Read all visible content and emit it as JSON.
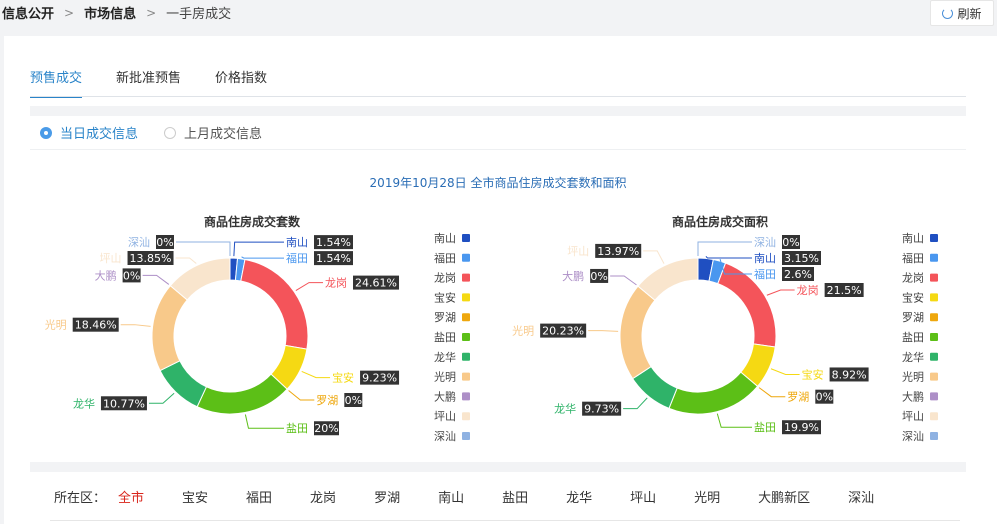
{
  "breadcrumb": {
    "items": [
      "信息公开",
      "市场信息",
      "一手房成交"
    ]
  },
  "refresh_label": "刷新",
  "tabs": [
    "预售成交",
    "新批准预售",
    "价格指数"
  ],
  "radios": [
    "当日成交信息",
    "上月成交信息"
  ],
  "main_title": "2019年10月28日 全市商品住房成交套数和面积",
  "district_filter": {
    "label": "所在区：",
    "items": [
      "全市",
      "宝安",
      "福田",
      "龙岗",
      "罗湖",
      "南山",
      "盐田",
      "龙华",
      "坪山",
      "光明",
      "大鹏新区",
      "深汕"
    ],
    "selected": "全市"
  },
  "chart_data": [
    {
      "type": "pie",
      "title": "商品住房成交套数",
      "categories": [
        "南山",
        "福田",
        "龙岗",
        "宝安",
        "罗湖",
        "盐田",
        "龙华",
        "光明",
        "大鹏",
        "坪山",
        "深汕"
      ],
      "values": [
        1.54,
        1.54,
        24.61,
        9.23,
        0,
        20,
        10.77,
        18.46,
        0,
        13.85,
        0
      ],
      "labels": [
        "1.54%",
        "1.54%",
        "24.61%",
        "9.23%",
        "0%",
        "20%",
        "10.77%",
        "18.46%",
        "0%",
        "13.85%",
        "0%"
      ],
      "legend": "right"
    },
    {
      "type": "pie",
      "title": "商品住房成交面积",
      "categories": [
        "南山",
        "福田",
        "龙岗",
        "宝安",
        "罗湖",
        "盐田",
        "龙华",
        "光明",
        "大鹏",
        "坪山",
        "深汕"
      ],
      "values": [
        3.15,
        2.6,
        21.5,
        8.92,
        0,
        19.9,
        9.73,
        20.23,
        0,
        13.97,
        0
      ],
      "labels": [
        "3.15%",
        "2.6%",
        "21.5%",
        "8.92%",
        "0%",
        "19.9%",
        "9.73%",
        "20.23%",
        "0%",
        "13.97%",
        "0%"
      ],
      "legend": "right"
    }
  ],
  "colors": {
    "南山": "#1f4fc1",
    "福田": "#4a97ef",
    "龙岗": "#f4545a",
    "宝安": "#f5d913",
    "罗湖": "#eea70d",
    "盐田": "#5cbf17",
    "龙华": "#2fb369",
    "光明": "#f8c98a",
    "大鹏": "#ad8fc7",
    "坪山": "#f9e5cd",
    "深汕": "#8fb2e2"
  }
}
